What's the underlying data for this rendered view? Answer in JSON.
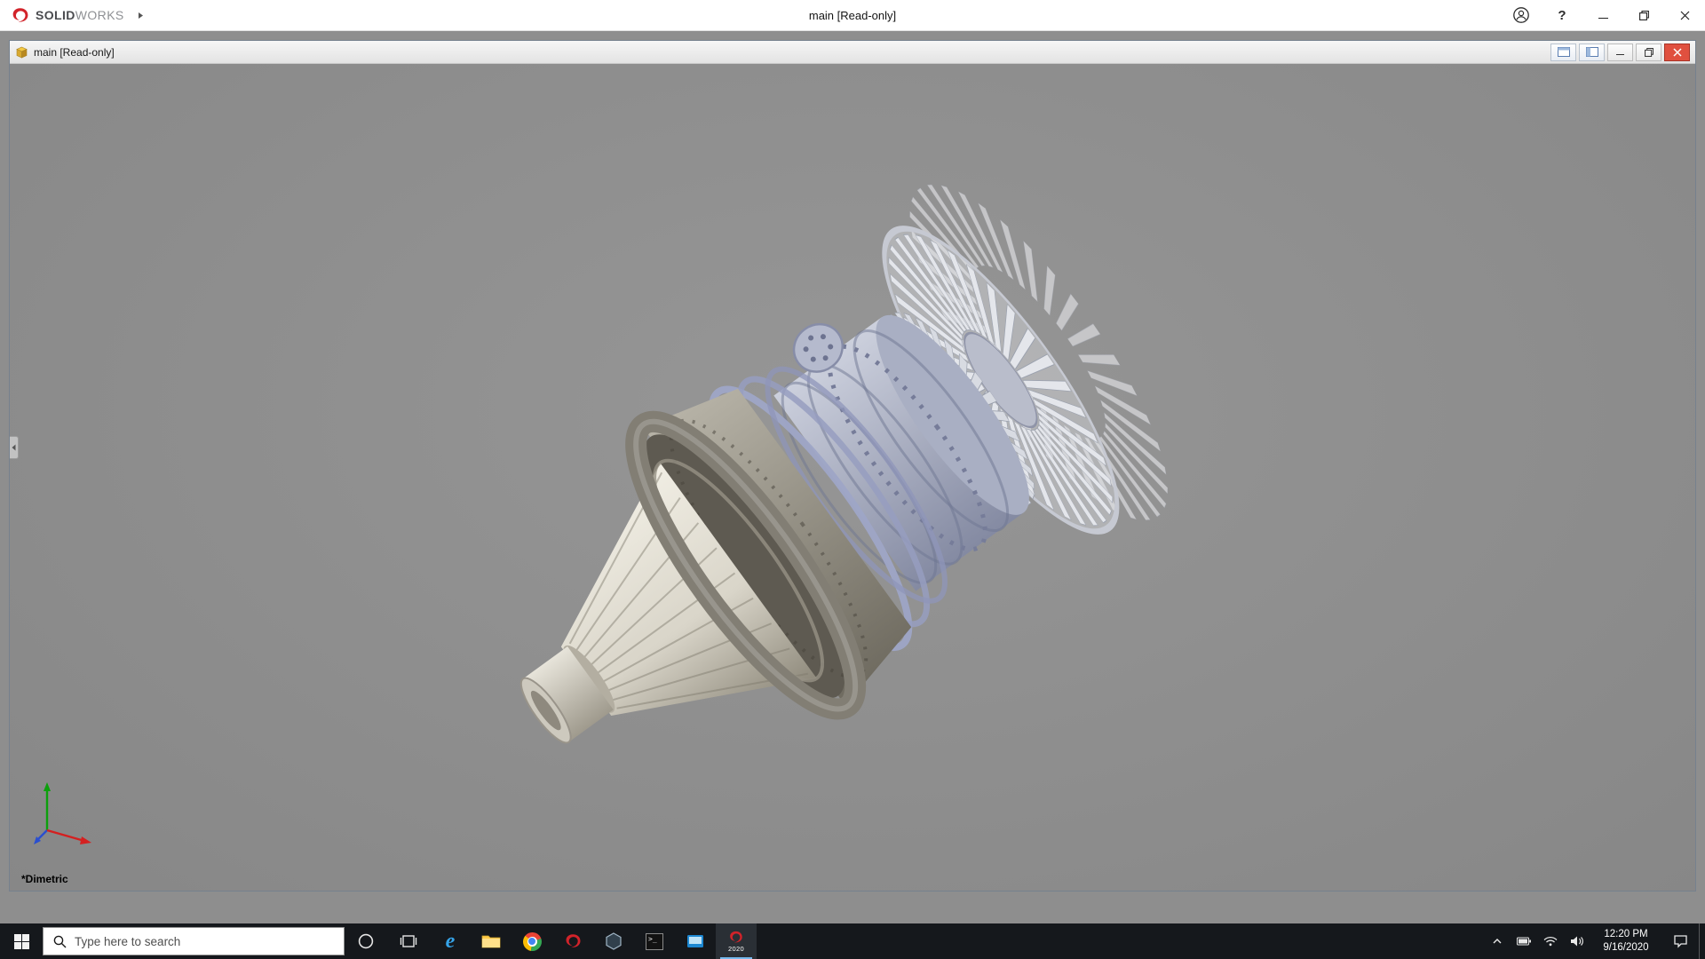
{
  "colors": {
    "logo_red": "#d2232a",
    "close_red": "#e0503f",
    "edge_blue": "#35a3e8",
    "viewport_gray": "#8f8f8f",
    "taskbar_bg": "#15181c",
    "active_app_accent": "#76b9ed"
  },
  "app": {
    "brand_bold": "SOLID",
    "brand_light": "WORKS",
    "title": "main [Read-only]",
    "help_glyph": "?"
  },
  "doc": {
    "title": "main [Read-only]"
  },
  "viewport": {
    "view_label": "*Dimetric"
  },
  "taskbar": {
    "search_placeholder": "Type here to search",
    "edge_glyph": "e",
    "cmd_glyph": "&gt;_",
    "solidworks_year": "2020",
    "clock_time": "12:20 PM",
    "clock_date": "9/16/2020"
  }
}
